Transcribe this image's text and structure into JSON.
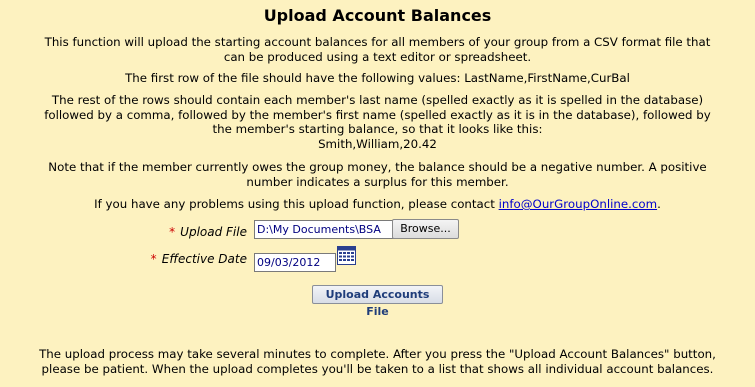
{
  "title": "Upload Account Balances",
  "instructions": {
    "p1": "This function will upload the starting account balances for all members of your group from a CSV format file that can be produced using a text editor or spreadsheet.",
    "p2": "The first row of the file should have the following values: LastName,FirstName,CurBal",
    "p3": "The rest of the rows should contain each member's last name (spelled exactly as it is spelled in the database) followed by a comma, followed by the member's first name (spelled exactly as it is in the database), followed by the member's starting balance, so that it looks like this:",
    "p3_example": "Smith,William,20.42",
    "p4": "Note that if the member currently owes the group money, the balance should be a negative number. A positive number indicates a surplus for this member.",
    "p5_before": "If you have any problems using this upload function, please contact ",
    "p5_email": "info@OurGroupOnline.com",
    "p5_after": "."
  },
  "form": {
    "required_mark": "*",
    "upload_file_label": "Upload File",
    "upload_file_value": "D:\\My Documents\\BSA",
    "browse_label": "Browse...",
    "effective_date_label": "Effective Date",
    "effective_date_value": "09/03/2012",
    "calendar_icon": "calendar-icon",
    "submit_label": "Upload Accounts File"
  },
  "footer_note": "The upload process may take several minutes to complete. After you press the \"Upload Account Balances\" button, please be patient. When the upload completes you'll be taken to a list that shows all individual account balances."
}
